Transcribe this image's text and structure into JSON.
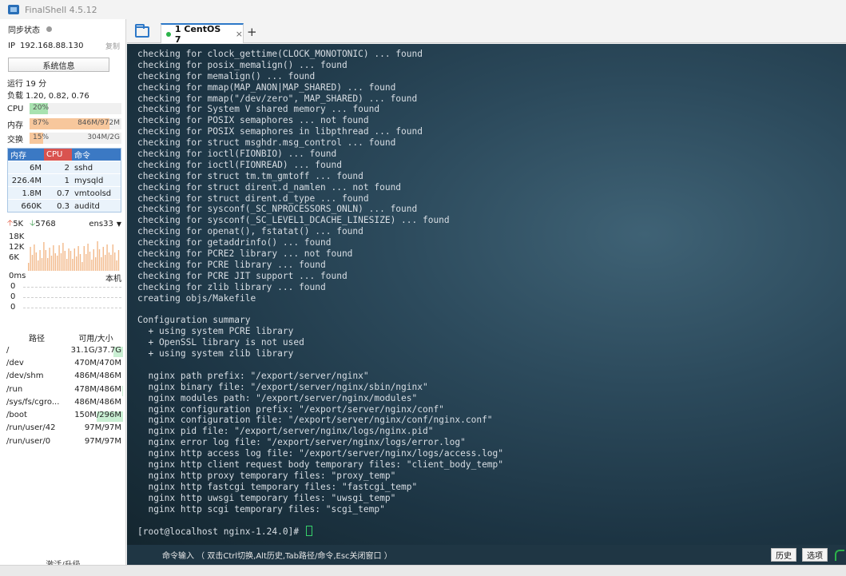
{
  "window": {
    "title": "FinalShell 4.5.12"
  },
  "sidebar": {
    "sync_label": "同步状态",
    "ip_label": "IP",
    "ip_value": "192.168.88.130",
    "copy_label": "复制",
    "sysinfo_button": "系统信息",
    "uptime": "运行 19 分",
    "load": "负载 1.20, 0.82, 0.76",
    "cpu": {
      "label": "CPU",
      "percent_text": "20%",
      "fraction": 0.2,
      "color": "#a8e2b0"
    },
    "mem": {
      "label": "内存",
      "percent_text": "87%",
      "usage": "846M/972M",
      "fraction": 0.87,
      "color": "#f7c79c"
    },
    "swap": {
      "label": "交换",
      "percent_text": "15%",
      "usage": "304M/2G",
      "fraction": 0.15,
      "color": "#f7c79c"
    },
    "process_table": {
      "headers": {
        "mem": "内存",
        "cpu": "CPU",
        "cmd": "命令"
      },
      "rows": [
        {
          "mem": "6M",
          "cpu": "2",
          "cmd": "sshd"
        },
        {
          "mem": "226.4M",
          "cpu": "1",
          "cmd": "mysqld"
        },
        {
          "mem": "1.8M",
          "cpu": "0.7",
          "cmd": "vmtoolsd"
        },
        {
          "mem": "660K",
          "cpu": "0.3",
          "cmd": "auditd"
        }
      ]
    },
    "network": {
      "up": "5K",
      "down": "5768",
      "interface": "ens33",
      "y_ticks": [
        "18K",
        "12K",
        "6K"
      ]
    },
    "latency": {
      "unit": "0ms",
      "host": "本机",
      "values": [
        "0",
        "0",
        "0"
      ]
    },
    "disk_table": {
      "headers": {
        "path": "路径",
        "avail": "可用/大小"
      },
      "rows": [
        {
          "path": "/",
          "avail": "31.1G/37.7G",
          "used_fraction": 0.18
        },
        {
          "path": "/dev",
          "avail": "470M/470M",
          "used_fraction": 0.0
        },
        {
          "path": "/dev/shm",
          "avail": "486M/486M",
          "used_fraction": 0.0
        },
        {
          "path": "/run",
          "avail": "478M/486M",
          "used_fraction": 0.02
        },
        {
          "path": "/sys/fs/cgro...",
          "avail": "486M/486M",
          "used_fraction": 0.0
        },
        {
          "path": "/boot",
          "avail": "150M/296M",
          "used_fraction": 0.49
        },
        {
          "path": "/run/user/42",
          "avail": "97M/97M",
          "used_fraction": 0.0
        },
        {
          "path": "/run/user/0",
          "avail": "97M/97M",
          "used_fraction": 0.0
        }
      ]
    },
    "upgrade_label": "激活/升级"
  },
  "tabs": [
    {
      "label": "1 CentOS 7",
      "close": "×",
      "active": true
    }
  ],
  "add_tab": "+",
  "terminal": {
    "lines": [
      "checking for clock_gettime(CLOCK_MONOTONIC) ... found",
      "checking for posix_memalign() ... found",
      "checking for memalign() ... found",
      "checking for mmap(MAP_ANON|MAP_SHARED) ... found",
      "checking for mmap(\"/dev/zero\", MAP_SHARED) ... found",
      "checking for System V shared memory ... found",
      "checking for POSIX semaphores ... not found",
      "checking for POSIX semaphores in libpthread ... found",
      "checking for struct msghdr.msg_control ... found",
      "checking for ioctl(FIONBIO) ... found",
      "checking for ioctl(FIONREAD) ... found",
      "checking for struct tm.tm_gmtoff ... found",
      "checking for struct dirent.d_namlen ... not found",
      "checking for struct dirent.d_type ... found",
      "checking for sysconf(_SC_NPROCESSORS_ONLN) ... found",
      "checking for sysconf(_SC_LEVEL1_DCACHE_LINESIZE) ... found",
      "checking for openat(), fstatat() ... found",
      "checking for getaddrinfo() ... found",
      "checking for PCRE2 library ... not found",
      "checking for PCRE library ... found",
      "checking for PCRE JIT support ... found",
      "checking for zlib library ... found",
      "creating objs/Makefile",
      "",
      "Configuration summary",
      "  + using system PCRE library",
      "  + OpenSSL library is not used",
      "  + using system zlib library",
      "",
      "  nginx path prefix: \"/export/server/nginx\"",
      "  nginx binary file: \"/export/server/nginx/sbin/nginx\"",
      "  nginx modules path: \"/export/server/nginx/modules\"",
      "  nginx configuration prefix: \"/export/server/nginx/conf\"",
      "  nginx configuration file: \"/export/server/nginx/conf/nginx.conf\"",
      "  nginx pid file: \"/export/server/nginx/logs/nginx.pid\"",
      "  nginx error log file: \"/export/server/nginx/logs/error.log\"",
      "  nginx http access log file: \"/export/server/nginx/logs/access.log\"",
      "  nginx http client request body temporary files: \"client_body_temp\"",
      "  nginx http proxy temporary files: \"proxy_temp\"",
      "  nginx http fastcgi temporary files: \"fastcgi_temp\"",
      "  nginx http uwsgi temporary files: \"uwsgi_temp\"",
      "  nginx http scgi temporary files: \"scgi_temp\"",
      ""
    ],
    "prompt": "[root@localhost nginx-1.24.0]# "
  },
  "command_bar": {
    "hint": "命令输入 （ 双击Ctrl切换,Alt历史,Tab路径/命令,Esc关闭窗口 ）",
    "history_button": "历史",
    "options_button": "选项"
  }
}
